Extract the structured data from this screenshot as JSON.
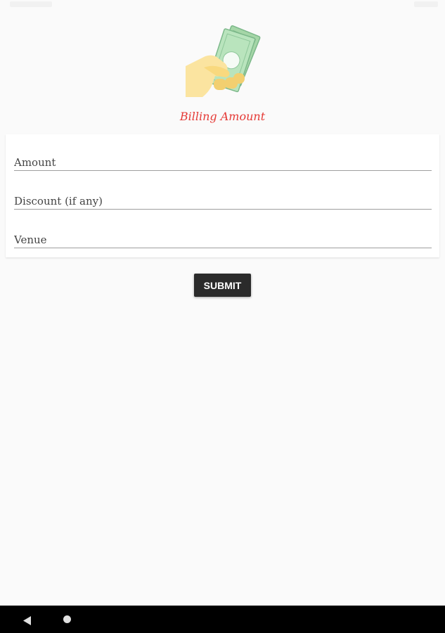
{
  "app": {
    "title": "Billing Amount",
    "accent_color": "#e53935",
    "hero_icon": "hand-holding-money-icon"
  },
  "form": {
    "fields": [
      {
        "placeholder": "Amount",
        "value": ""
      },
      {
        "placeholder": "Discount (if any)",
        "value": ""
      },
      {
        "placeholder": "Venue",
        "value": ""
      }
    ]
  },
  "actions": {
    "submit_label": "SUBMIT"
  },
  "navigation": {
    "back_icon": "back-triangle-icon",
    "home_icon": "home-circle-icon"
  }
}
